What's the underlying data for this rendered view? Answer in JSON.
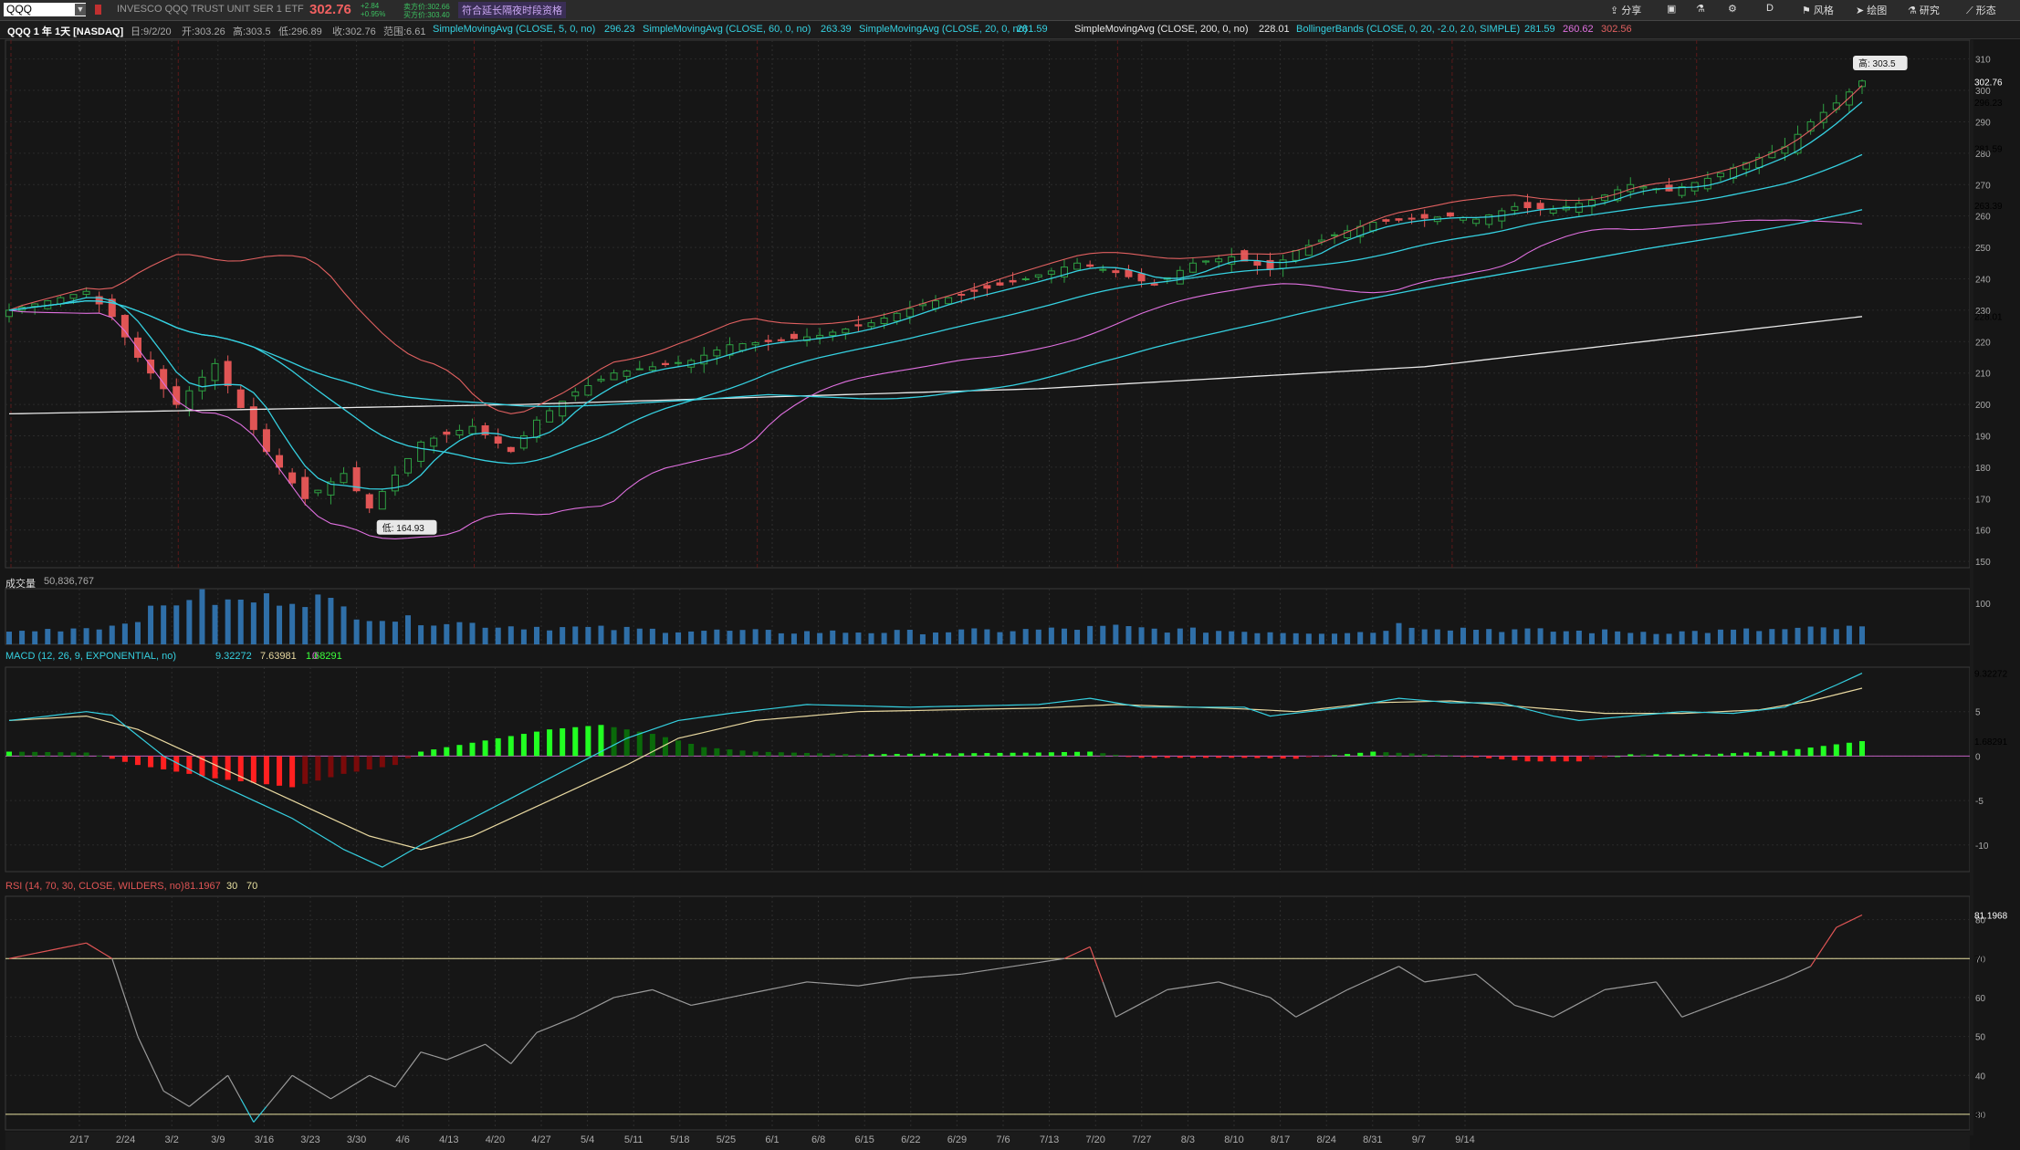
{
  "topbar": {
    "symbol": "QQQ",
    "description": "INVESCO QQQ TRUST UNIT SER 1 ETF",
    "last": "302.76",
    "change": "+2.84",
    "change_pct": "+0.95%",
    "bid": "卖方价:302.66",
    "ask": "买方价:303.40",
    "ext_hours": "符合延长隔夜时段资格",
    "buttons": {
      "share": "分享",
      "interval": "D",
      "style": "风格",
      "draw": "绘图",
      "studies": "研究",
      "patterns": "形态"
    }
  },
  "infobar": {
    "title": "QQQ 1 年 1天 [NASDAQ]",
    "date": "日:9/2/20",
    "open": "开:303.26",
    "high": "高:303.5",
    "low": "低:296.89",
    "close": "收:302.76",
    "range": "范围:6.61",
    "studies": [
      {
        "label": "SimpleMovingAvg (CLOSE, 5, 0, no)",
        "value": "296.23",
        "color": "#35d0e0"
      },
      {
        "label": "SimpleMovingAvg (CLOSE, 60, 0, no)",
        "value": "263.39",
        "color": "#35d0e0"
      },
      {
        "label": "SimpleMovingAvg (CLOSE, 20, 0, no)",
        "value": "281.59",
        "color": "#35d0e0"
      },
      {
        "label": "SimpleMovingAvg (CLOSE, 200, 0, no)",
        "value": "228.01",
        "color": "#e8e8e8"
      },
      {
        "label": "BollingerBands (CLOSE, 0, 20, -2.0, 2.0, SIMPLE)",
        "values": [
          "281.59",
          "260.62",
          "302.56"
        ],
        "colors": [
          "#35d0e0",
          "#e070e0",
          "#e06060"
        ]
      }
    ]
  },
  "volume_panel": {
    "label": "成交量",
    "value": "50,836,767"
  },
  "macd_panel": {
    "label": "MACD (12, 26, 9, EXPONENTIAL, no)",
    "values": [
      "9.32272",
      "7.63981",
      "1.68291",
      "0"
    ]
  },
  "rsi_panel": {
    "label": "RSI (14, 70, 30, CLOSE, WILDERS, no)",
    "values": [
      "81.1967",
      "30",
      "70"
    ]
  },
  "price_tags": {
    "last": "302.76",
    "sma5": "296.23",
    "sma20": "281.59",
    "sma60": "263.39",
    "sma200": "228.01",
    "macd": "9.32272",
    "macd_diff": "1.68291",
    "rsi": "81.1968"
  },
  "annotations": {
    "high": "高: 303.5",
    "low": "低: 164.93"
  },
  "colors": {
    "up": "#2ea043",
    "down": "#e05555",
    "sma5": "#35d0e0",
    "sma20": "#35d0e0",
    "sma200": "#e8e8e8",
    "bb_upper": "#e06060",
    "bb_lower": "#e070e0",
    "macd": "#35d0e0",
    "signal": "#e8d8a0",
    "rsi": "#9a9a9a",
    "level": "#e8e0a0"
  },
  "chart_data": [
    {
      "type": "candlestick",
      "title": "QQQ 1 年 1天 [NASDAQ]",
      "x_ticks": [
        "2/17",
        "2/24",
        "3/2",
        "3/9",
        "3/16",
        "3/23",
        "3/30",
        "4/6",
        "4/13",
        "4/20",
        "4/27",
        "5/4",
        "5/11",
        "5/18",
        "5/25",
        "6/1",
        "6/8",
        "6/15",
        "6/22",
        "6/29",
        "7/6",
        "7/13",
        "7/20",
        "7/27",
        "8/3",
        "8/10",
        "8/17",
        "8/24",
        "8/31",
        "9/7",
        "9/14"
      ],
      "y_ticks": [
        150,
        160,
        170,
        180,
        190,
        200,
        210,
        220,
        230,
        240,
        250,
        260,
        270,
        280,
        290,
        300,
        310
      ],
      "ylim": [
        148,
        316
      ],
      "close_keypoints": [
        [
          0,
          230
        ],
        [
          6,
          236
        ],
        [
          8,
          228
        ],
        [
          10,
          215
        ],
        [
          13,
          200
        ],
        [
          16,
          213
        ],
        [
          20,
          185
        ],
        [
          23,
          170
        ],
        [
          26,
          178
        ],
        [
          28,
          167
        ],
        [
          32,
          188
        ],
        [
          36,
          193
        ],
        [
          39,
          185
        ],
        [
          41,
          195
        ],
        [
          44,
          204
        ],
        [
          47,
          210
        ],
        [
          50,
          212
        ],
        [
          53,
          214
        ],
        [
          56,
          219
        ],
        [
          59,
          220
        ],
        [
          63,
          222
        ],
        [
          67,
          226
        ],
        [
          71,
          232
        ],
        [
          75,
          236
        ],
        [
          79,
          240
        ],
        [
          83,
          245
        ],
        [
          86,
          242
        ],
        [
          89,
          238
        ],
        [
          92,
          245
        ],
        [
          95,
          247
        ],
        [
          98,
          243
        ],
        [
          100,
          249
        ],
        [
          103,
          254
        ],
        [
          106,
          258
        ],
        [
          109,
          259
        ],
        [
          112,
          260
        ],
        [
          114,
          259
        ],
        [
          117,
          263
        ],
        [
          120,
          262
        ],
        [
          123,
          265
        ],
        [
          126,
          270
        ],
        [
          129,
          268
        ],
        [
          132,
          272
        ],
        [
          135,
          277
        ],
        [
          138,
          282
        ],
        [
          140,
          290
        ],
        [
          142,
          296
        ],
        [
          144,
          303
        ]
      ],
      "series": [
        {
          "name": "SimpleMovingAvg (CLOSE, 5, 0, no)",
          "values_ref": "sma5"
        },
        {
          "name": "SimpleMovingAvg (CLOSE, 20, 0, no)",
          "values_ref": "sma20"
        },
        {
          "name": "SimpleMovingAvg (CLOSE, 60, 0, no)",
          "values_ref": "sma60"
        },
        {
          "name": "SimpleMovingAvg (CLOSE, 200, 0, no)",
          "keypoints": [
            [
              0,
              197
            ],
            [
              40,
              200
            ],
            [
              80,
              205
            ],
            [
              110,
              212
            ],
            [
              144,
              228
            ]
          ]
        },
        {
          "name": "BollingerBands (CLOSE, 0, 20, -2.0, 2.0, SIMPLE)",
          "values_ref": "bb"
        }
      ],
      "high": 303.5,
      "low": 164.93
    },
    {
      "type": "bar",
      "title": "成交量",
      "y_ticks": [
        100
      ],
      "last": 50.84,
      "keypoints": [
        [
          0,
          30
        ],
        [
          8,
          45
        ],
        [
          12,
          90
        ],
        [
          14,
          120
        ],
        [
          17,
          100
        ],
        [
          22,
          115
        ],
        [
          24,
          110
        ],
        [
          27,
          75
        ],
        [
          30,
          60
        ],
        [
          34,
          55
        ],
        [
          38,
          45
        ],
        [
          44,
          40
        ],
        [
          50,
          35
        ],
        [
          60,
          30
        ],
        [
          70,
          30
        ],
        [
          80,
          35
        ],
        [
          86,
          42
        ],
        [
          90,
          35
        ],
        [
          100,
          30
        ],
        [
          106,
          30
        ],
        [
          108,
          48
        ],
        [
          112,
          40
        ],
        [
          120,
          32
        ],
        [
          130,
          30
        ],
        [
          144,
          40
        ]
      ]
    },
    {
      "type": "line",
      "title": "MACD (12, 26, 9, EXPONENTIAL, no)",
      "y_ticks": [
        -10,
        -5,
        0,
        5
      ],
      "ylim": [
        -13,
        10
      ],
      "series": [
        {
          "name": "MACD",
          "keypoints": [
            [
              0,
              4
            ],
            [
              6,
              5
            ],
            [
              8,
              4.6
            ],
            [
              12,
              0
            ],
            [
              16,
              -3
            ],
            [
              22,
              -7
            ],
            [
              26,
              -10.5
            ],
            [
              29,
              -12.5
            ],
            [
              32,
              -10
            ],
            [
              36,
              -7
            ],
            [
              40,
              -4
            ],
            [
              44,
              -1
            ],
            [
              48,
              2
            ],
            [
              52,
              4
            ],
            [
              56,
              4.8
            ],
            [
              62,
              5.8
            ],
            [
              70,
              5.5
            ],
            [
              80,
              5.8
            ],
            [
              84,
              6.5
            ],
            [
              88,
              5.5
            ],
            [
              96,
              5.5
            ],
            [
              98,
              4.5
            ],
            [
              104,
              5.5
            ],
            [
              108,
              6.5
            ],
            [
              112,
              6
            ],
            [
              116,
              6
            ],
            [
              120,
              4.5
            ],
            [
              122,
              4
            ],
            [
              126,
              4.5
            ],
            [
              130,
              5
            ],
            [
              134,
              4.8
            ],
            [
              138,
              5.5
            ],
            [
              142,
              8
            ],
            [
              144,
              9.32
            ]
          ]
        },
        {
          "name": "Signal",
          "keypoints": [
            [
              0,
              4
            ],
            [
              6,
              4.5
            ],
            [
              10,
              3
            ],
            [
              16,
              -1
            ],
            [
              22,
              -5
            ],
            [
              28,
              -9
            ],
            [
              32,
              -10.5
            ],
            [
              36,
              -9
            ],
            [
              42,
              -5
            ],
            [
              48,
              -1
            ],
            [
              52,
              2
            ],
            [
              58,
              4
            ],
            [
              66,
              5
            ],
            [
              80,
              5.4
            ],
            [
              86,
              5.8
            ],
            [
              96,
              5.3
            ],
            [
              100,
              5.0
            ],
            [
              106,
              6
            ],
            [
              112,
              6.2
            ],
            [
              118,
              5.5
            ],
            [
              124,
              4.8
            ],
            [
              130,
              4.8
            ],
            [
              136,
              5.2
            ],
            [
              140,
              6.2
            ],
            [
              144,
              7.64
            ]
          ]
        },
        {
          "name": "Diff",
          "keypoints": [
            [
              0,
              0.5
            ],
            [
              6,
              0.4
            ],
            [
              10,
              -1
            ],
            [
              16,
              -2.5
            ],
            [
              22,
              -3.5
            ],
            [
              26,
              -2
            ],
            [
              30,
              -1
            ],
            [
              32,
              0.5
            ],
            [
              36,
              1.5
            ],
            [
              42,
              3
            ],
            [
              46,
              3.5
            ],
            [
              50,
              2.5
            ],
            [
              54,
              1
            ],
            [
              58,
              0.5
            ],
            [
              66,
              0.2
            ],
            [
              80,
              0.4
            ],
            [
              84,
              0.5
            ],
            [
              88,
              -0.2
            ],
            [
              96,
              -0.2
            ],
            [
              100,
              -0.3
            ],
            [
              106,
              0.5
            ],
            [
              112,
              0.1
            ],
            [
              118,
              -0.6
            ],
            [
              122,
              -0.6
            ],
            [
              126,
              0.2
            ],
            [
              132,
              0.2
            ],
            [
              138,
              0.6
            ],
            [
              144,
              1.68
            ]
          ]
        }
      ]
    },
    {
      "type": "line",
      "title": "RSI (14, 70, 30, CLOSE, WILDERS, no)",
      "y_ticks": [
        30,
        40,
        50,
        60,
        70,
        80
      ],
      "ylim": [
        26,
        86
      ],
      "levels": [
        30,
        70
      ],
      "last": 81.1967,
      "keypoints": [
        [
          0,
          70
        ],
        [
          3,
          72
        ],
        [
          6,
          74
        ],
        [
          8,
          70
        ],
        [
          10,
          50
        ],
        [
          12,
          36
        ],
        [
          14,
          32
        ],
        [
          17,
          40
        ],
        [
          19,
          28
        ],
        [
          22,
          40
        ],
        [
          25,
          34
        ],
        [
          28,
          40
        ],
        [
          30,
          37
        ],
        [
          32,
          46
        ],
        [
          34,
          44
        ],
        [
          37,
          48
        ],
        [
          39,
          43
        ],
        [
          41,
          51
        ],
        [
          44,
          55
        ],
        [
          47,
          60
        ],
        [
          50,
          62
        ],
        [
          53,
          58
        ],
        [
          56,
          60
        ],
        [
          59,
          62
        ],
        [
          62,
          64
        ],
        [
          66,
          63
        ],
        [
          70,
          65
        ],
        [
          74,
          66
        ],
        [
          78,
          68
        ],
        [
          82,
          70
        ],
        [
          84,
          73
        ],
        [
          86,
          55
        ],
        [
          90,
          62
        ],
        [
          94,
          64
        ],
        [
          98,
          60
        ],
        [
          100,
          55
        ],
        [
          104,
          62
        ],
        [
          108,
          68
        ],
        [
          110,
          64
        ],
        [
          114,
          66
        ],
        [
          117,
          58
        ],
        [
          120,
          55
        ],
        [
          124,
          62
        ],
        [
          128,
          64
        ],
        [
          130,
          55
        ],
        [
          134,
          60
        ],
        [
          138,
          65
        ],
        [
          140,
          68
        ],
        [
          142,
          78
        ],
        [
          144,
          81.2
        ]
      ]
    }
  ]
}
